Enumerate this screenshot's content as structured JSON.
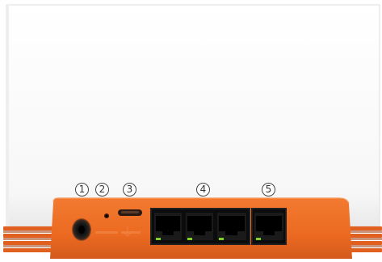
{
  "photo": {
    "subject": "router-rear-panel",
    "colors": {
      "housing": "#fbfbfb",
      "panel": "#ec6a22",
      "panel_dark": "#c9511a",
      "vent": "#e2601f",
      "port_black": "#111111",
      "led_green": "#7ed321"
    },
    "callouts": [
      {
        "label": "1",
        "target": "power-jack"
      },
      {
        "label": "2",
        "target": "reset-pinhole"
      },
      {
        "label": "3",
        "target": "wps-slot-button"
      },
      {
        "label": "4",
        "target": "lan-ports"
      },
      {
        "label": "5",
        "target": "wan-port"
      }
    ]
  }
}
